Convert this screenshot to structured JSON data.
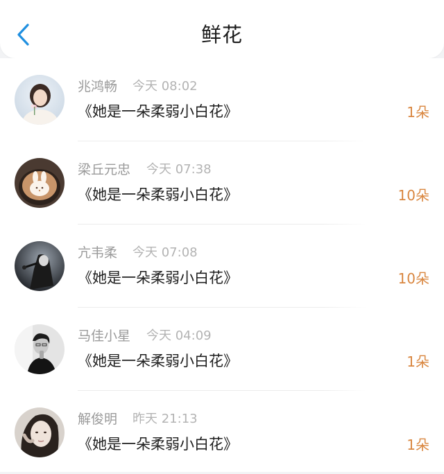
{
  "header": {
    "title": "鲜花",
    "back_icon": "chevron-left-icon",
    "accent_color": "#1f8fe0"
  },
  "items": [
    {
      "name": "兆鸿畅",
      "time": "今天 08:02",
      "book": "《她是一朵柔弱小白花》",
      "count": "1朵"
    },
    {
      "name": "梁丘元忠",
      "time": "今天 07:38",
      "book": "《她是一朵柔弱小白花》",
      "count": "10朵"
    },
    {
      "name": "亢韦柔",
      "time": "今天 07:08",
      "book": "《她是一朵柔弱小白花》",
      "count": "10朵"
    },
    {
      "name": "马佳小星",
      "time": "今天 04:09",
      "book": "《她是一朵柔弱小白花》",
      "count": "1朵"
    },
    {
      "name": "解俊明",
      "time": "昨天 21:13",
      "book": "《她是一朵柔弱小白花》",
      "count": "1朵"
    }
  ],
  "colors": {
    "count": "#d9863f",
    "name": "#9a9a9a",
    "time": "#b3b3b3"
  }
}
